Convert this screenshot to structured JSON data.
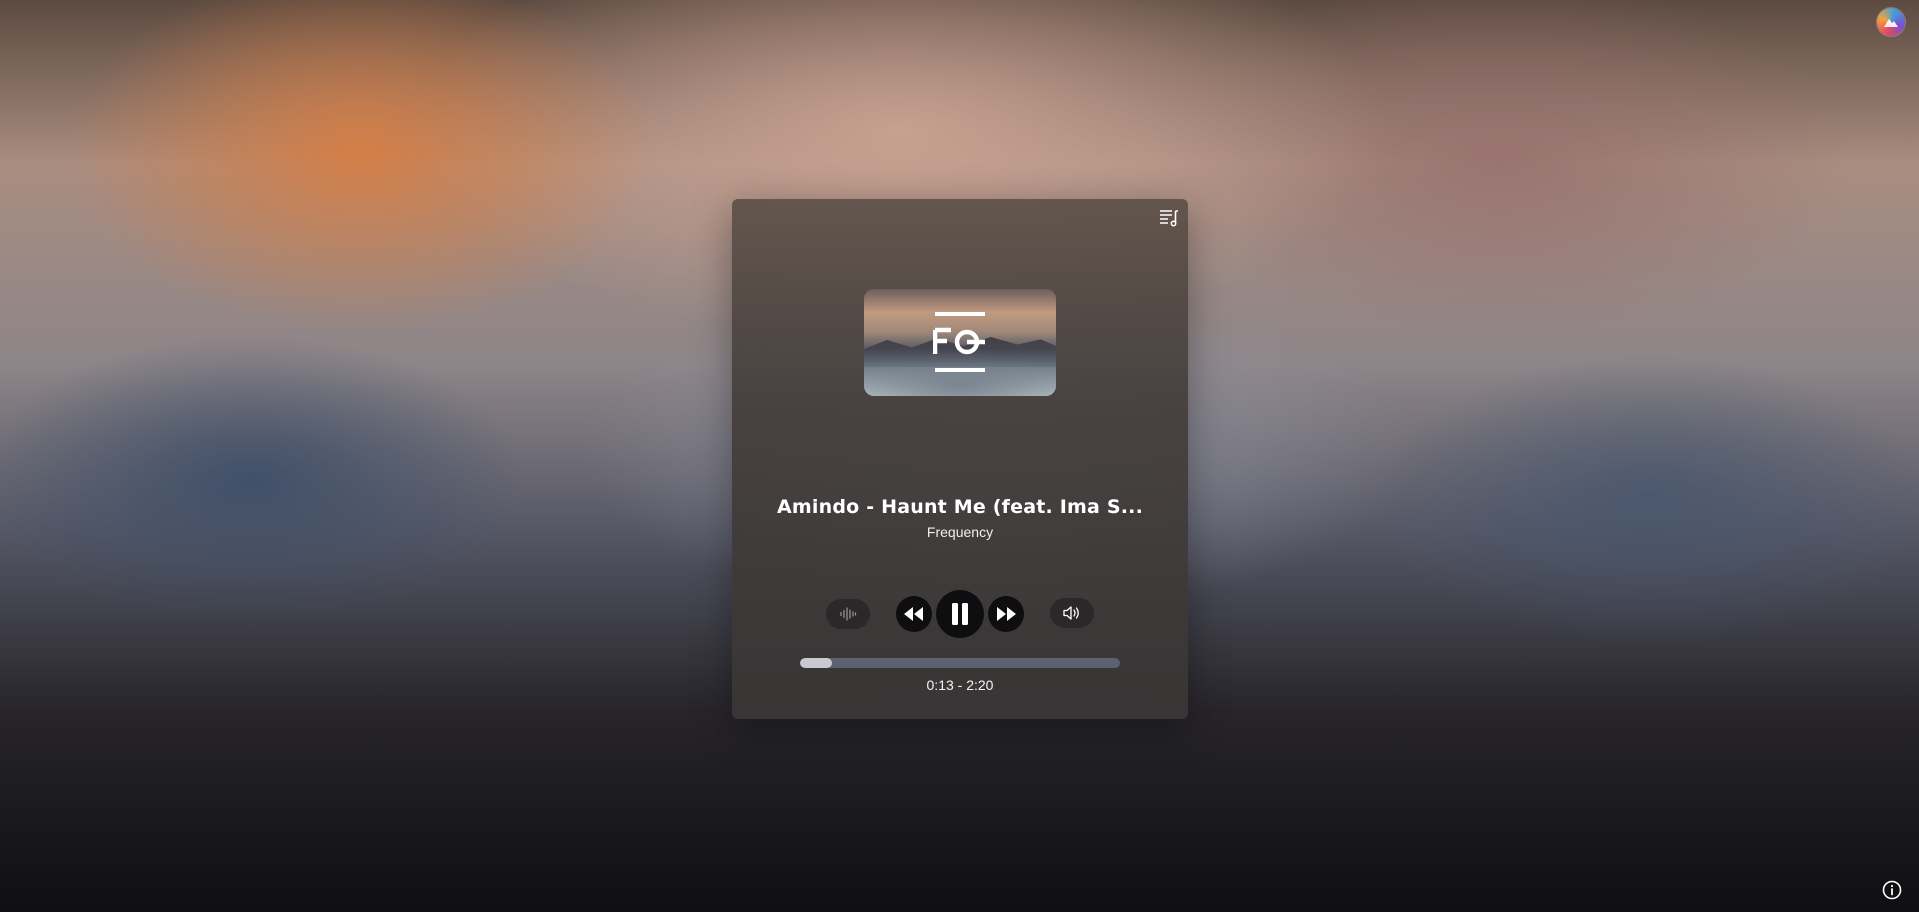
{
  "player": {
    "title": "Amindo - Haunt Me (feat. Ima S...",
    "artist": "Frequency",
    "time": {
      "current": "0:13",
      "separator": " - ",
      "total": "2:20"
    },
    "progress_fraction": 0.1,
    "cover_logo_text": "FO",
    "is_playing": true
  },
  "icons": {
    "queue": "playlist-icon",
    "visualizer": "waveform-icon",
    "rewind": "rewind-icon",
    "pause": "pause-icon",
    "fast_forward": "fast-forward-icon",
    "volume": "volume-icon",
    "avatar": "user-avatar",
    "info": "info-icon"
  },
  "colors": {
    "progress_track": "#5d6070",
    "progress_fill": "#c9c9cf",
    "button_bg": "#0e0e10"
  }
}
